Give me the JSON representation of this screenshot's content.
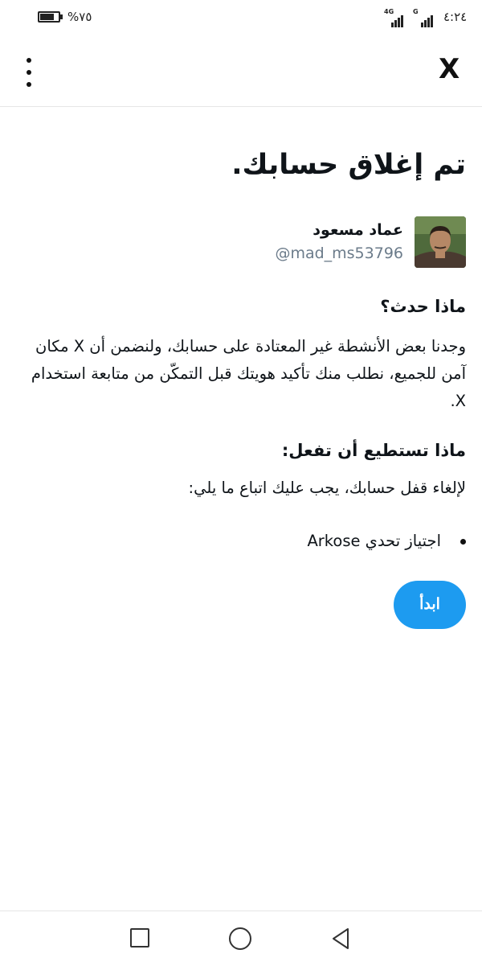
{
  "status_bar": {
    "battery_percent": "%٧٥",
    "battery_level": 0.75,
    "network_4g": "4G",
    "network_g": "G",
    "time": "٤:٢٤"
  },
  "header": {
    "menu_icon": "more-vertical-icon",
    "close_label": "X"
  },
  "content": {
    "title": "تم إغلاق حسابك.",
    "user": {
      "display_name": "عماد مسعود",
      "handle": "@mad_ms53796"
    },
    "what_happened": {
      "heading": "ماذا حدث؟",
      "body": "وجدنا بعض الأنشطة غير المعتادة على حسابك، ولنضمن أن X مكان آمن للجميع، نطلب منك تأكيد هويتك قبل التمكّن من متابعة استخدام X."
    },
    "what_to_do": {
      "heading": "ماذا تستطيع أن تفعل:",
      "body": "لإلغاء قفل حسابك، يجب عليك اتباع ما يلي:",
      "steps": [
        "اجتياز تحدي Arkose"
      ]
    },
    "start_button": "ابدأ"
  },
  "nav_bar": {
    "icons": [
      "recents-square-icon",
      "home-circle-icon",
      "back-triangle-icon"
    ]
  },
  "colors": {
    "accent": "#1d9bf0",
    "text": "#0f1419",
    "secondary_text": "#6b7b8a"
  }
}
